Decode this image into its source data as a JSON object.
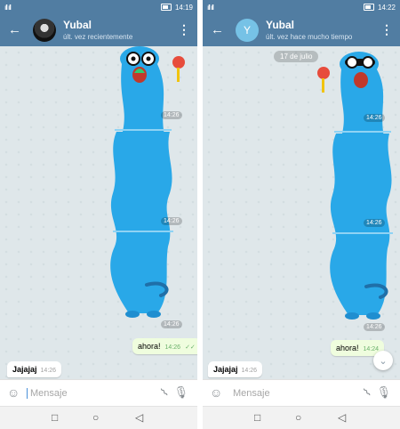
{
  "left": {
    "status_bar": {
      "signal": "ıll ıll",
      "time": "14:19"
    },
    "header": {
      "contact_name": "Yubal",
      "last_seen": "últ. vez recientemente"
    },
    "sticker_times": [
      "14:26",
      "14:26",
      "14:26",
      "14:26"
    ],
    "outgoing": {
      "text": "ahora!",
      "time": "14:26"
    },
    "incoming": {
      "text": "Jajajaj",
      "time": "14:26"
    },
    "input": {
      "placeholder": "Mensaje"
    }
  },
  "right": {
    "status_bar": {
      "signal": "ıll ıll",
      "time": "14:22"
    },
    "header": {
      "contact_name": "Yubal",
      "avatar_letter": "Y",
      "last_seen": "últ. vez hace mucho tiempo"
    },
    "date_pill": "17 de julio",
    "sticker_times": [
      "14:26",
      "14:26",
      "14:26",
      "14:26"
    ],
    "outgoing": {
      "text": "ahora!",
      "time": "14:24"
    },
    "incoming": {
      "text": "Jajajaj",
      "time": "14:26"
    },
    "input": {
      "placeholder": "Mensaje"
    }
  },
  "colors": {
    "header": "#517da2",
    "outgoing_bubble": "#effdde",
    "sticker": "#29a8e8",
    "accent": "#4a90d9"
  },
  "icons": [
    "back-arrow-icon",
    "more-vert-icon",
    "emoji-icon",
    "attach-icon",
    "mic-icon",
    "nav-square-icon",
    "nav-home-icon",
    "nav-back-icon",
    "chevron-down-icon"
  ]
}
